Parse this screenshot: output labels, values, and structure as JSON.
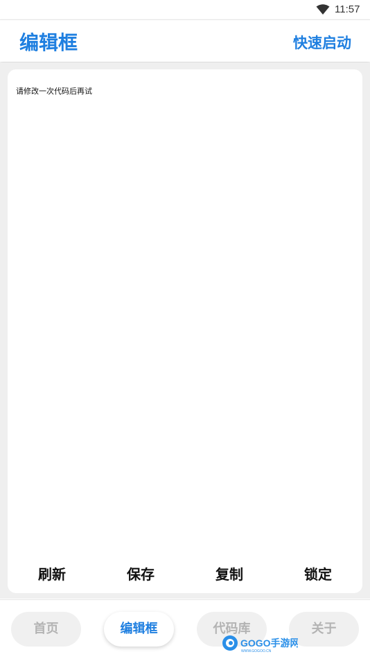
{
  "status_bar": {
    "time": "11:57",
    "wifi_icon": "wifi-icon"
  },
  "app_bar": {
    "title": "编辑框",
    "quick_start": "快速启动"
  },
  "editor": {
    "text": "请修改一次代码后再试"
  },
  "actions": [
    {
      "label": "刷新"
    },
    {
      "label": "保存"
    },
    {
      "label": "复制"
    },
    {
      "label": "锁定"
    }
  ],
  "bottom_nav": {
    "tabs": [
      {
        "label": "首页",
        "active": false
      },
      {
        "label": "编辑框",
        "active": true
      },
      {
        "label": "代码库",
        "active": false
      },
      {
        "label": "关于",
        "active": false
      }
    ]
  },
  "watermark": {
    "text": "GOGO手游网",
    "sub": "WWW.GOGOO.CN"
  },
  "colors": {
    "accent": "#1f7fe0",
    "background": "#efefef",
    "inactive_tab_text": "#b3b3b3"
  }
}
